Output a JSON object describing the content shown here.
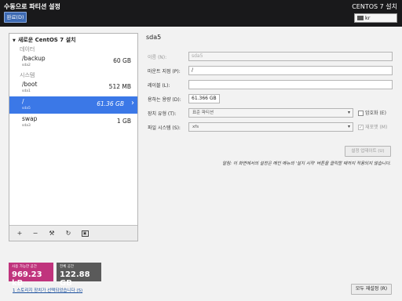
{
  "header": {
    "title": "수동으로 파티션 설정",
    "done_label": "완료(D)",
    "product": "CENTOS 7 설치",
    "keyboard": "kr",
    "keyboard_icon": "keyboard-icon"
  },
  "tree": {
    "title": "새로운 CentOS 7 설치",
    "groups": [
      {
        "label": "데이터"
      },
      {
        "label": "시스템"
      }
    ],
    "mounts": [
      {
        "name": "/backup",
        "device": "sda2",
        "size": "60 GB"
      },
      {
        "name": "/boot",
        "device": "sda1",
        "size": "512 MB"
      },
      {
        "name": "/",
        "device": "sda5",
        "size": "61.36 GB"
      },
      {
        "name": "swap",
        "device": "sda3",
        "size": "1 GB"
      }
    ]
  },
  "toolbar": {
    "add": "+",
    "remove": "−",
    "configure": "⚒",
    "refresh": "↻",
    "disk": "▣"
  },
  "space": {
    "available_label": "사용 가능한 공간",
    "available_value": "969.23 kB",
    "total_label": "전체 공간",
    "total_value": "122.88 GB"
  },
  "storage_link": "1 스토리지 장치가 선택되었습니다 (S)",
  "detail": {
    "title": "sda5",
    "name_label": "이름 (N):",
    "name_value": "sda5",
    "mount_label": "마운트 지점 (P):",
    "mount_value": "/",
    "label_label": "레이블 (L):",
    "label_value": "",
    "capacity_label": "용하는 용량 (D):",
    "capacity_value": "61.366 GB",
    "device_type_label": "장치 유형 (T):",
    "device_type_value": "표준 파티션",
    "encrypt_label": "암호화 (E)",
    "fs_label": "파일 시스템 (S):",
    "fs_value": "xfs",
    "reformat_label": "재포맷 (M)",
    "update_label": "설정 업데이트 (U)",
    "note": "알림: 이 화면에서의 설정은 메인 메뉴의 '설치 시작' 버튼을 클릭할 때까지 적용되지 않습니다."
  },
  "reset_label": "모두 재설정 (R)"
}
